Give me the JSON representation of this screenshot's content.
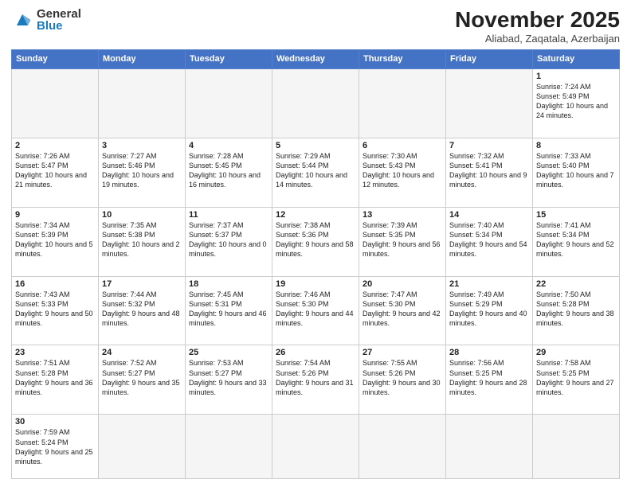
{
  "logo": {
    "general": "General",
    "blue": "Blue"
  },
  "header": {
    "month_year": "November 2025",
    "location": "Aliabad, Zaqatala, Azerbaijan"
  },
  "days_of_week": [
    "Sunday",
    "Monday",
    "Tuesday",
    "Wednesday",
    "Thursday",
    "Friday",
    "Saturday"
  ],
  "weeks": [
    [
      {
        "day": "",
        "info": ""
      },
      {
        "day": "",
        "info": ""
      },
      {
        "day": "",
        "info": ""
      },
      {
        "day": "",
        "info": ""
      },
      {
        "day": "",
        "info": ""
      },
      {
        "day": "",
        "info": ""
      },
      {
        "day": "1",
        "info": "Sunrise: 7:24 AM\nSunset: 5:49 PM\nDaylight: 10 hours and 24 minutes."
      }
    ],
    [
      {
        "day": "2",
        "info": "Sunrise: 7:26 AM\nSunset: 5:47 PM\nDaylight: 10 hours and 21 minutes."
      },
      {
        "day": "3",
        "info": "Sunrise: 7:27 AM\nSunset: 5:46 PM\nDaylight: 10 hours and 19 minutes."
      },
      {
        "day": "4",
        "info": "Sunrise: 7:28 AM\nSunset: 5:45 PM\nDaylight: 10 hours and 16 minutes."
      },
      {
        "day": "5",
        "info": "Sunrise: 7:29 AM\nSunset: 5:44 PM\nDaylight: 10 hours and 14 minutes."
      },
      {
        "day": "6",
        "info": "Sunrise: 7:30 AM\nSunset: 5:43 PM\nDaylight: 10 hours and 12 minutes."
      },
      {
        "day": "7",
        "info": "Sunrise: 7:32 AM\nSunset: 5:41 PM\nDaylight: 10 hours and 9 minutes."
      },
      {
        "day": "8",
        "info": "Sunrise: 7:33 AM\nSunset: 5:40 PM\nDaylight: 10 hours and 7 minutes."
      }
    ],
    [
      {
        "day": "9",
        "info": "Sunrise: 7:34 AM\nSunset: 5:39 PM\nDaylight: 10 hours and 5 minutes."
      },
      {
        "day": "10",
        "info": "Sunrise: 7:35 AM\nSunset: 5:38 PM\nDaylight: 10 hours and 2 minutes."
      },
      {
        "day": "11",
        "info": "Sunrise: 7:37 AM\nSunset: 5:37 PM\nDaylight: 10 hours and 0 minutes."
      },
      {
        "day": "12",
        "info": "Sunrise: 7:38 AM\nSunset: 5:36 PM\nDaylight: 9 hours and 58 minutes."
      },
      {
        "day": "13",
        "info": "Sunrise: 7:39 AM\nSunset: 5:35 PM\nDaylight: 9 hours and 56 minutes."
      },
      {
        "day": "14",
        "info": "Sunrise: 7:40 AM\nSunset: 5:34 PM\nDaylight: 9 hours and 54 minutes."
      },
      {
        "day": "15",
        "info": "Sunrise: 7:41 AM\nSunset: 5:34 PM\nDaylight: 9 hours and 52 minutes."
      }
    ],
    [
      {
        "day": "16",
        "info": "Sunrise: 7:43 AM\nSunset: 5:33 PM\nDaylight: 9 hours and 50 minutes."
      },
      {
        "day": "17",
        "info": "Sunrise: 7:44 AM\nSunset: 5:32 PM\nDaylight: 9 hours and 48 minutes."
      },
      {
        "day": "18",
        "info": "Sunrise: 7:45 AM\nSunset: 5:31 PM\nDaylight: 9 hours and 46 minutes."
      },
      {
        "day": "19",
        "info": "Sunrise: 7:46 AM\nSunset: 5:30 PM\nDaylight: 9 hours and 44 minutes."
      },
      {
        "day": "20",
        "info": "Sunrise: 7:47 AM\nSunset: 5:30 PM\nDaylight: 9 hours and 42 minutes."
      },
      {
        "day": "21",
        "info": "Sunrise: 7:49 AM\nSunset: 5:29 PM\nDaylight: 9 hours and 40 minutes."
      },
      {
        "day": "22",
        "info": "Sunrise: 7:50 AM\nSunset: 5:28 PM\nDaylight: 9 hours and 38 minutes."
      }
    ],
    [
      {
        "day": "23",
        "info": "Sunrise: 7:51 AM\nSunset: 5:28 PM\nDaylight: 9 hours and 36 minutes."
      },
      {
        "day": "24",
        "info": "Sunrise: 7:52 AM\nSunset: 5:27 PM\nDaylight: 9 hours and 35 minutes."
      },
      {
        "day": "25",
        "info": "Sunrise: 7:53 AM\nSunset: 5:27 PM\nDaylight: 9 hours and 33 minutes."
      },
      {
        "day": "26",
        "info": "Sunrise: 7:54 AM\nSunset: 5:26 PM\nDaylight: 9 hours and 31 minutes."
      },
      {
        "day": "27",
        "info": "Sunrise: 7:55 AM\nSunset: 5:26 PM\nDaylight: 9 hours and 30 minutes."
      },
      {
        "day": "28",
        "info": "Sunrise: 7:56 AM\nSunset: 5:25 PM\nDaylight: 9 hours and 28 minutes."
      },
      {
        "day": "29",
        "info": "Sunrise: 7:58 AM\nSunset: 5:25 PM\nDaylight: 9 hours and 27 minutes."
      }
    ],
    [
      {
        "day": "30",
        "info": "Sunrise: 7:59 AM\nSunset: 5:24 PM\nDaylight: 9 hours and 25 minutes."
      },
      {
        "day": "",
        "info": ""
      },
      {
        "day": "",
        "info": ""
      },
      {
        "day": "",
        "info": ""
      },
      {
        "day": "",
        "info": ""
      },
      {
        "day": "",
        "info": ""
      },
      {
        "day": "",
        "info": ""
      }
    ]
  ]
}
